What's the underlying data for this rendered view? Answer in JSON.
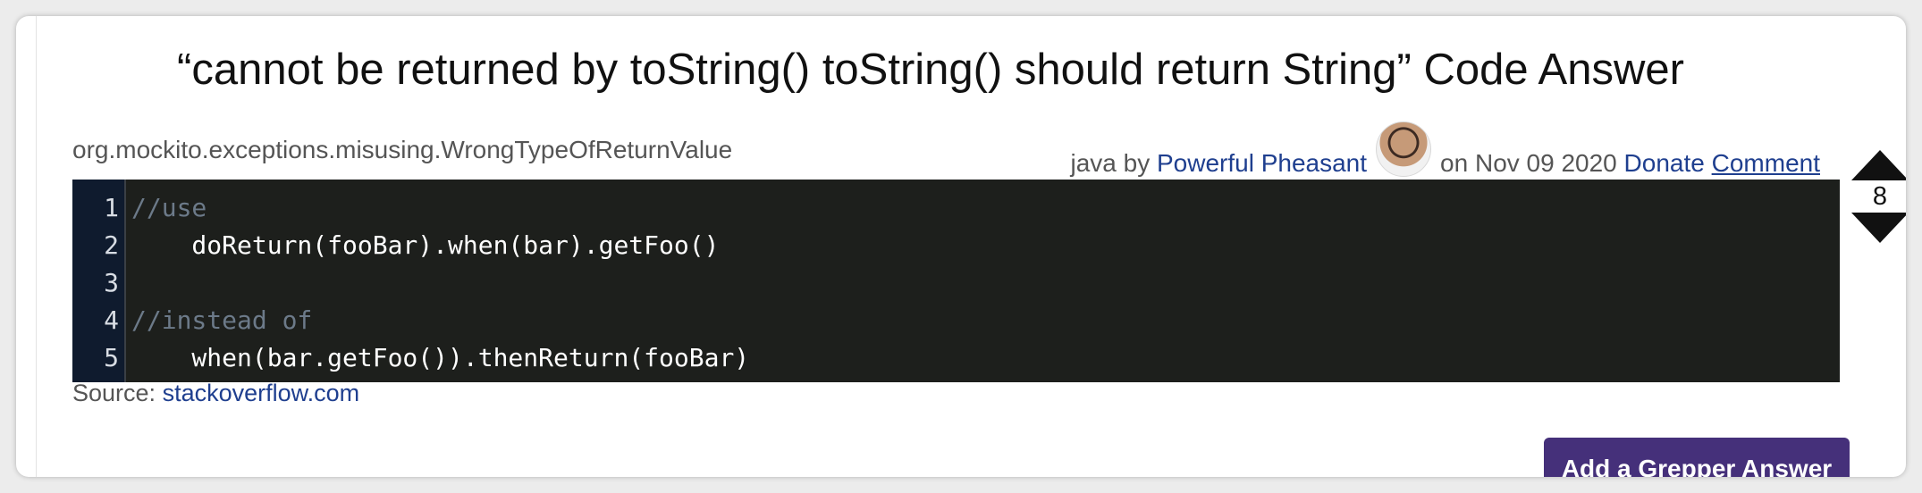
{
  "title": "“cannot be returned by toString() toString() should return String” Code Answer",
  "subtitle": "org.mockito.exceptions.misusing.WrongTypeOfReturnValue",
  "meta": {
    "language": "java",
    "by": "by",
    "author": "Powerful Pheasant",
    "on_date": "on Nov 09 2020",
    "donate": "Donate",
    "comment": "Comment"
  },
  "vote": {
    "count": "8"
  },
  "code": {
    "line_numbers": [
      "1",
      "2",
      "3",
      "4",
      "5"
    ],
    "lines": [
      "//use",
      "    doReturn(fooBar).when(bar).getFoo()",
      "",
      "//instead of",
      "    when(bar.getFoo()).thenReturn(fooBar)"
    ]
  },
  "source": {
    "label": "Source:",
    "link": "stackoverflow.com"
  },
  "add_answer_button": "Add a Grepper Answer"
}
